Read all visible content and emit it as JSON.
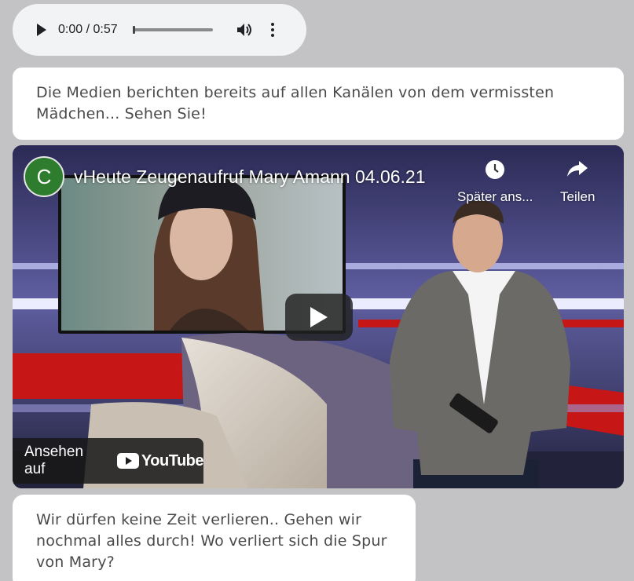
{
  "audio": {
    "time_display": "0:00 / 0:57",
    "progress": 0
  },
  "messages": [
    {
      "text": "Die Medien berichten bereits auf allen Kanälen von dem vermissten Mädchen... Sehen Sie!"
    },
    {
      "text": "Wir dürfen keine Zeit verlieren.. Gehen wir nochmal alles durch! Wo verliert sich die Spur von Mary?"
    }
  ],
  "video": {
    "channel_initial": "C",
    "title": "vHeute Zeugenaufruf Mary Amann 04.06.21",
    "watch_later_label": "Später ans...",
    "share_label": "Teilen",
    "watch_on_label": "Ansehen auf",
    "youtube_label": "YouTube",
    "colors": {
      "channel_avatar": "#2e7d2e",
      "youtube_red": "#ff0000"
    }
  }
}
